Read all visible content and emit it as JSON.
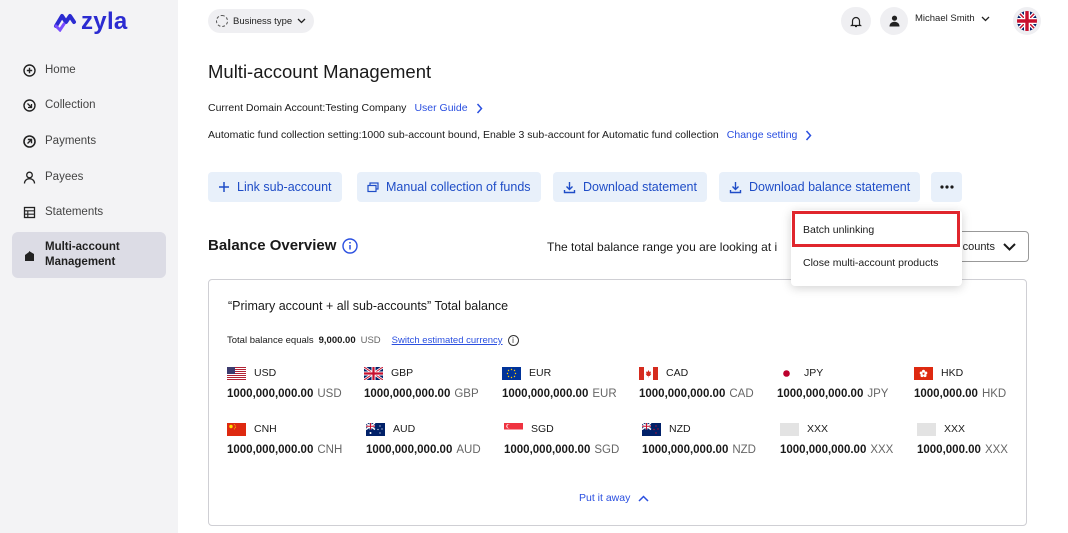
{
  "brand": {
    "name": "zyla",
    "color": "#2b2bd1"
  },
  "sidebar": {
    "items": [
      {
        "label": "Home",
        "icon": "plus-circle-icon"
      },
      {
        "label": "Collection",
        "icon": "collection-icon"
      },
      {
        "label": "Payments",
        "icon": "payments-icon"
      },
      {
        "label": "Payees",
        "icon": "payees-icon"
      },
      {
        "label": "Statements",
        "icon": "statements-icon"
      },
      {
        "label": "Multi-account Management",
        "icon": "buildings-icon",
        "active": true
      }
    ]
  },
  "topbar": {
    "business_type": "Business type",
    "user_name": "Michael Smith",
    "language_flag": "uk-flag-icon"
  },
  "page": {
    "title": "Multi-account Management",
    "domain_label": "Current Domain Account:",
    "domain_value": "Testing Company",
    "user_guide": "User Guide",
    "fund_label": "Automatic fund collection setting:",
    "fund_value": "1000 sub-account bound,  Enable 3 sub-account for Automatic fund collection",
    "change_setting": "Change setting"
  },
  "actions": {
    "link_sub": "Link sub-account",
    "manual_collection": "Manual collection of funds",
    "download_statement": "Download statement",
    "download_balance": "Download balance statement",
    "more": "..."
  },
  "menu": {
    "items": [
      "Batch unlinking",
      "Close multi-account products"
    ]
  },
  "balance": {
    "title": "Balance Overview",
    "range_text": "The total balance range you are looking at i",
    "range_select": "counts",
    "card_title": "“Primary account + all sub-accounts” Total balance",
    "total_label": "Total balance equals",
    "total_value": "9,000.00",
    "total_unit": "USD",
    "switch_currency": "Switch estimated currency",
    "put_away": "Put it away",
    "currencies": [
      {
        "code": "USD",
        "amount": "1000,000,000.00",
        "unit": "USD"
      },
      {
        "code": "GBP",
        "amount": "1000,000,000.00",
        "unit": "GBP"
      },
      {
        "code": "EUR",
        "amount": "1000,000,000.00",
        "unit": "EUR"
      },
      {
        "code": "CAD",
        "amount": "1000,000,000.00",
        "unit": "CAD"
      },
      {
        "code": "JPY",
        "amount": "1000,000,000.00",
        "unit": "JPY"
      },
      {
        "code": "HKD",
        "amount": "1000,000.00",
        "unit": "HKD"
      },
      {
        "code": "CNH",
        "amount": "1000,000,000.00",
        "unit": "CNH"
      },
      {
        "code": "AUD",
        "amount": "1000,000,000.00",
        "unit": "AUD"
      },
      {
        "code": "SGD",
        "amount": "1000,000,000.00",
        "unit": "SGD"
      },
      {
        "code": "NZD",
        "amount": "1000,000,000.00",
        "unit": "NZD"
      },
      {
        "code": "XXX",
        "amount": "1000,000,000.00",
        "unit": "XXX"
      },
      {
        "code": "XXX",
        "amount": "1000,000.00",
        "unit": "XXX"
      }
    ]
  },
  "colors": {
    "link": "#2a4fe0",
    "highlight": "#e0262d",
    "button_bg": "#e8f0fa",
    "sidebar_bg": "#f3f3f5"
  }
}
